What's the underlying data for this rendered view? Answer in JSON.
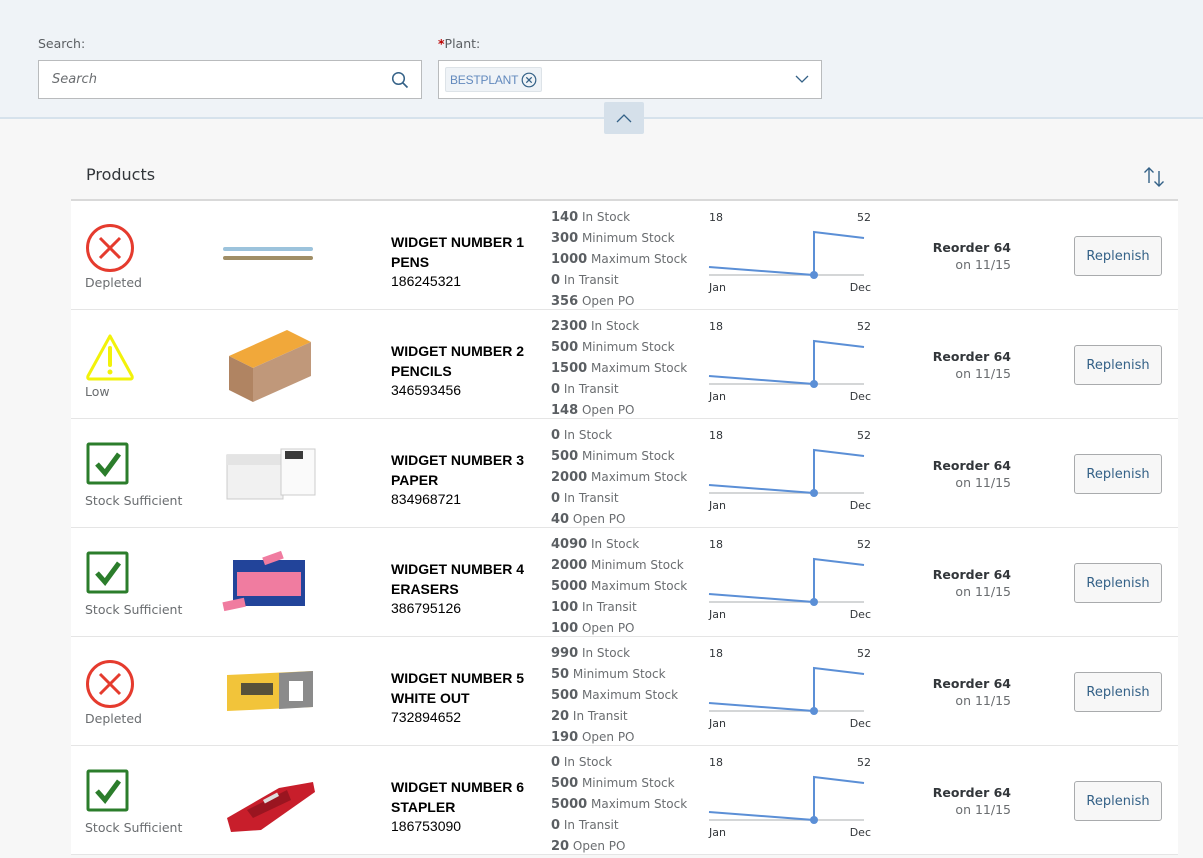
{
  "filters": {
    "search_label": "Search:",
    "search_placeholder": "Search",
    "search_value": "",
    "plant_label": "Plant:",
    "plant_required_marker": "*",
    "plant_tokens": [
      "BESTPLANT"
    ]
  },
  "products_title": "Products",
  "colors": {
    "depleted": "#e53b2e",
    "low": "#f2f20a",
    "sufficient": "#2b7d2b",
    "chart_line": "#5b8fd6",
    "accent": "#346187"
  },
  "rows": [
    {
      "status": "depleted",
      "status_label": "Depleted",
      "status_icon": "error-circle-icon",
      "image": "pens-image",
      "name": "WIDGET NUMBER 1",
      "category": "PENS",
      "id": "186245321",
      "stats": [
        {
          "value": "140",
          "label": "In Stock"
        },
        {
          "value": "300",
          "label": "Minimum Stock"
        },
        {
          "value": "1000",
          "label": "Maximum Stock"
        },
        {
          "value": "0",
          "label": "In Transit"
        },
        {
          "value": "356",
          "label": "Open PO"
        }
      ],
      "chart": {
        "left_label": "18",
        "right_label": "52",
        "x_start": "Jan",
        "x_end": "Dec"
      },
      "reorder": "Reorder 64",
      "reorder_date": "on 11/15",
      "button": "Replenish"
    },
    {
      "status": "low",
      "status_label": "Low",
      "status_icon": "warning-triangle-icon",
      "image": "pencils-image",
      "name": "WIDGET NUMBER 2",
      "category": "PENCILS",
      "id": "346593456",
      "stats": [
        {
          "value": "2300",
          "label": "In Stock"
        },
        {
          "value": "500",
          "label": "Minimum Stock"
        },
        {
          "value": "1500",
          "label": "Maximum Stock"
        },
        {
          "value": "0",
          "label": "In Transit"
        },
        {
          "value": "148",
          "label": "Open PO"
        }
      ],
      "chart": {
        "left_label": "18",
        "right_label": "52",
        "x_start": "Jan",
        "x_end": "Dec"
      },
      "reorder": "Reorder 64",
      "reorder_date": "on 11/15",
      "button": "Replenish"
    },
    {
      "status": "sufficient",
      "status_label": "Stock Sufficient",
      "status_icon": "checkbox-check-icon",
      "image": "paper-image",
      "name": "WIDGET NUMBER 3",
      "category": "PAPER",
      "id": "834968721",
      "stats": [
        {
          "value": "0",
          "label": "In Stock"
        },
        {
          "value": "500",
          "label": "Minimum Stock"
        },
        {
          "value": "2000",
          "label": "Maximum Stock"
        },
        {
          "value": "0",
          "label": "In Transit"
        },
        {
          "value": "40",
          "label": "Open PO"
        }
      ],
      "chart": {
        "left_label": "18",
        "right_label": "52",
        "x_start": "Jan",
        "x_end": "Dec"
      },
      "reorder": "Reorder 64",
      "reorder_date": "on 11/15",
      "button": "Replenish"
    },
    {
      "status": "sufficient",
      "status_label": "Stock Sufficient",
      "status_icon": "checkbox-check-icon",
      "image": "erasers-image",
      "name": "WIDGET NUMBER 4",
      "category": "ERASERS",
      "id": "386795126",
      "stats": [
        {
          "value": "4090",
          "label": "In Stock"
        },
        {
          "value": "2000",
          "label": "Minimum Stock"
        },
        {
          "value": "5000",
          "label": "Maximum Stock"
        },
        {
          "value": "100",
          "label": "In Transit"
        },
        {
          "value": "100",
          "label": "Open PO"
        }
      ],
      "chart": {
        "left_label": "18",
        "right_label": "52",
        "x_start": "Jan",
        "x_end": "Dec"
      },
      "reorder": "Reorder 64",
      "reorder_date": "on 11/15",
      "button": "Replenish"
    },
    {
      "status": "depleted",
      "status_label": "Depleted",
      "status_icon": "error-circle-icon",
      "image": "white-out-image",
      "name": "WIDGET NUMBER 5",
      "category": "WHITE OUT",
      "id": "732894652",
      "stats": [
        {
          "value": "990",
          "label": "In Stock"
        },
        {
          "value": "50",
          "label": "Minimum Stock"
        },
        {
          "value": "500",
          "label": "Maximum Stock"
        },
        {
          "value": "20",
          "label": "In Transit"
        },
        {
          "value": "190",
          "label": "Open PO"
        }
      ],
      "chart": {
        "left_label": "18",
        "right_label": "52",
        "x_start": "Jan",
        "x_end": "Dec"
      },
      "reorder": "Reorder 64",
      "reorder_date": "on 11/15",
      "button": "Replenish"
    },
    {
      "status": "sufficient",
      "status_label": "Stock Sufficient",
      "status_icon": "checkbox-check-icon",
      "image": "stapler-image",
      "name": "WIDGET NUMBER 6",
      "category": "STAPLER",
      "id": "186753090",
      "stats": [
        {
          "value": "0",
          "label": "In Stock"
        },
        {
          "value": "500",
          "label": "Minimum Stock"
        },
        {
          "value": "5000",
          "label": "Maximum Stock"
        },
        {
          "value": "0",
          "label": "In Transit"
        },
        {
          "value": "20",
          "label": "Open PO"
        }
      ],
      "chart": {
        "left_label": "18",
        "right_label": "52",
        "x_start": "Jan",
        "x_end": "Dec"
      },
      "reorder": "Reorder 64",
      "reorder_date": "on 11/15",
      "button": "Replenish"
    }
  ]
}
